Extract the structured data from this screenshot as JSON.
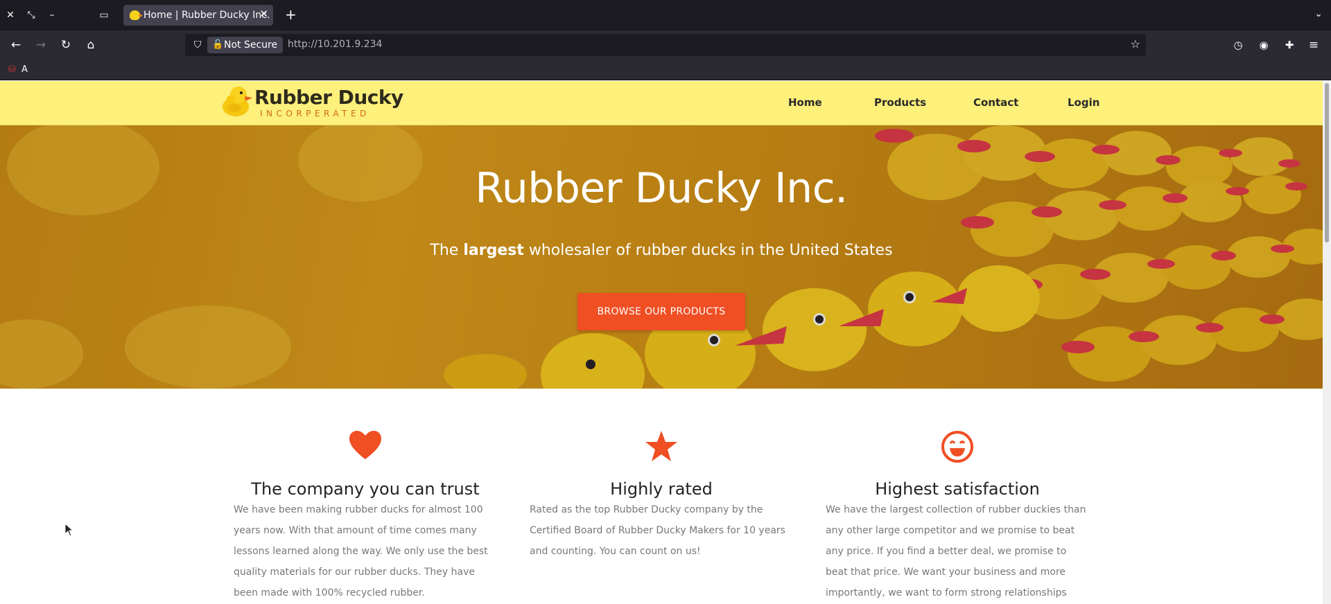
{
  "browser": {
    "tab": {
      "title": "Home | Rubber Ducky Inc."
    },
    "urlbar": {
      "security_label": "Not Secure",
      "url": "http://10.201.9.234"
    },
    "bookmarks": [
      {
        "label": "A"
      }
    ]
  },
  "site": {
    "logo": {
      "name": "Rubber Ducky",
      "sub": "INCORPERATED"
    },
    "nav": [
      {
        "label": "Home"
      },
      {
        "label": "Products"
      },
      {
        "label": "Contact"
      },
      {
        "label": "Login"
      }
    ],
    "hero": {
      "title": "Rubber Ducky Inc.",
      "tagline_pre": "The",
      "tagline_bold": "largest",
      "tagline_post": "wholesaler of rubber ducks in the United States",
      "cta": "BROWSE OUR PRODUCTS"
    },
    "features": [
      {
        "icon": "heart-icon",
        "title": "The company you can trust",
        "text": "We have been making rubber ducks for almost 100 years now. With that amount of time comes many lessons learned along the way. We only use the best quality materials for our rubber ducks. They have been made with 100% recycled rubber."
      },
      {
        "icon": "star-icon",
        "title": "Highly rated",
        "text": "Rated as the top Rubber Ducky company by the Certified Board of Rubber Ducky Makers for 10 years and counting. You can count on us!"
      },
      {
        "icon": "smile-icon",
        "title": "Highest satisfaction",
        "text": "We have the largest collection of rubber duckies than any other large competitor and we promise to beat any price. If you find a better deal, we promise to beat that price. We want your business and more importantly, we want to form strong relationships with our customers!"
      }
    ]
  },
  "colors": {
    "nav_bg": "#fdf07b",
    "accent": "#f04e23",
    "chrome_dark": "#1c1b22"
  }
}
